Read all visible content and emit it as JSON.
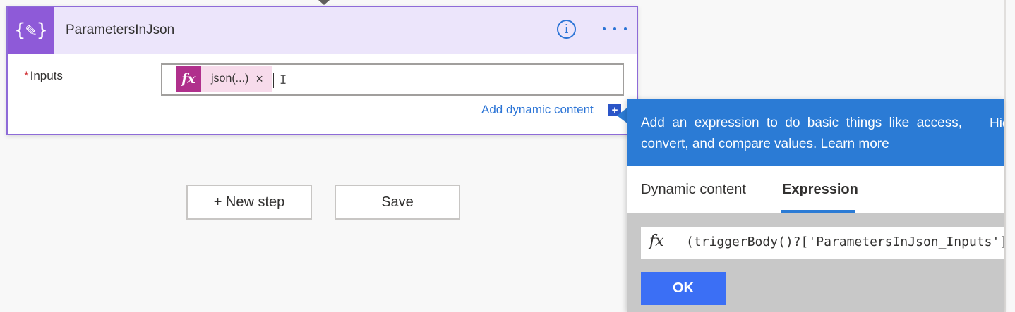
{
  "card": {
    "icon": "{✎}",
    "title": "ParametersInJson",
    "info_icon": "i",
    "more_icon": "ellipsis-icon"
  },
  "field": {
    "required_mark": "*",
    "label": "Inputs",
    "token": {
      "fx_icon": "fx",
      "label": "json(...)",
      "remove": "×"
    },
    "cursor": "I"
  },
  "add_dynamic_content": {
    "label": "Add dynamic content",
    "icon": "+"
  },
  "buttons": {
    "new_step": "+ New step",
    "save": "Save"
  },
  "flyout": {
    "description": "Add an expression to do basic things like access, convert, and compare values.",
    "learn_more": "Learn more",
    "hide": "Hide",
    "tabs": [
      {
        "label": "Dynamic content",
        "active": false
      },
      {
        "label": "Expression",
        "active": true
      }
    ],
    "expression": {
      "fx_icon": "fx",
      "value": "(triggerBody()?['ParametersInJson_Inputs'])"
    },
    "ok_label": "OK"
  },
  "colors": {
    "accent": "#8e5ad8",
    "header_bg": "#ece5fb",
    "link_blue": "#2b74d6",
    "token_bg": "#f7dbeb",
    "token_fx": "#b0308c",
    "flyout_blue": "#2b7bd5",
    "ok_button": "#3b6ff5"
  }
}
